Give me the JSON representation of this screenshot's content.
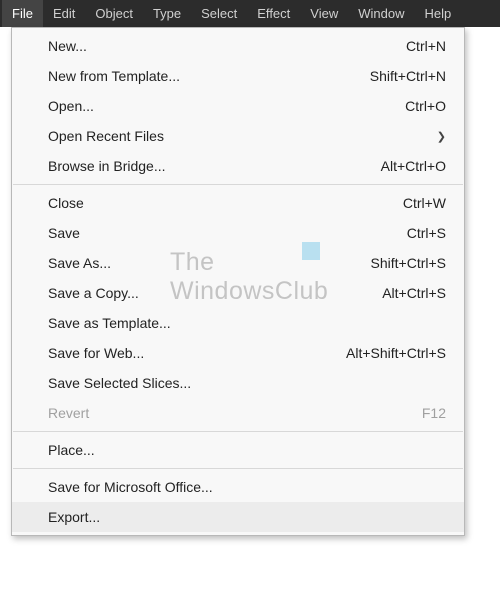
{
  "menu_bar": {
    "items": [
      "File",
      "Edit",
      "Object",
      "Type",
      "Select",
      "Effect",
      "View",
      "Window",
      "Help"
    ],
    "active_index": 0
  },
  "dropdown": {
    "items": [
      {
        "label": "New...",
        "shortcut": "Ctrl+N",
        "submenu": false,
        "disabled": false
      },
      {
        "label": "New from Template...",
        "shortcut": "Shift+Ctrl+N",
        "submenu": false,
        "disabled": false
      },
      {
        "label": "Open...",
        "shortcut": "Ctrl+O",
        "submenu": false,
        "disabled": false
      },
      {
        "label": "Open Recent Files",
        "shortcut": "",
        "submenu": true,
        "disabled": false
      },
      {
        "label": "Browse in Bridge...",
        "shortcut": "Alt+Ctrl+O",
        "submenu": false,
        "disabled": false
      },
      {
        "sep": true
      },
      {
        "label": "Close",
        "shortcut": "Ctrl+W",
        "submenu": false,
        "disabled": false
      },
      {
        "label": "Save",
        "shortcut": "Ctrl+S",
        "submenu": false,
        "disabled": false
      },
      {
        "label": "Save As...",
        "shortcut": "Shift+Ctrl+S",
        "submenu": false,
        "disabled": false
      },
      {
        "label": "Save a Copy...",
        "shortcut": "Alt+Ctrl+S",
        "submenu": false,
        "disabled": false
      },
      {
        "label": "Save as Template...",
        "shortcut": "",
        "submenu": false,
        "disabled": false
      },
      {
        "label": "Save for Web...",
        "shortcut": "Alt+Shift+Ctrl+S",
        "submenu": false,
        "disabled": false
      },
      {
        "label": "Save Selected Slices...",
        "shortcut": "",
        "submenu": false,
        "disabled": false
      },
      {
        "label": "Revert",
        "shortcut": "F12",
        "submenu": false,
        "disabled": true
      },
      {
        "sep": true
      },
      {
        "label": "Place...",
        "shortcut": "",
        "submenu": false,
        "disabled": false
      },
      {
        "sep": true
      },
      {
        "label": "Save for Microsoft Office...",
        "shortcut": "",
        "submenu": false,
        "disabled": false
      },
      {
        "label": "Export...",
        "shortcut": "",
        "submenu": false,
        "disabled": false,
        "hover": true
      }
    ]
  },
  "watermark": {
    "line1": "The",
    "line2": "WindowsClub"
  }
}
